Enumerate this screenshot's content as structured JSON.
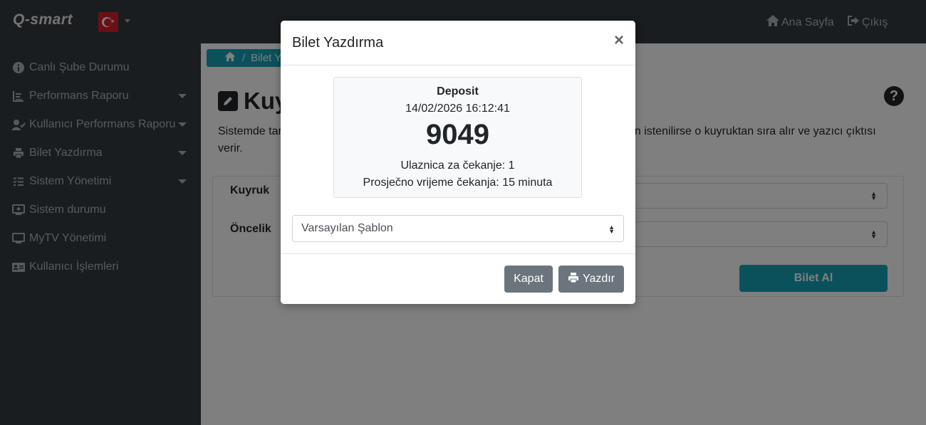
{
  "navbar": {
    "brand": "Q-smart",
    "flag_icon": "turkey-flag-icon",
    "home_label": "Ana Sayfa",
    "logout_label": "Çıkış"
  },
  "sidebar": {
    "items": [
      {
        "label": "Canlı Şube Durumu",
        "icon": "info-circle-icon",
        "has_caret": false
      },
      {
        "label": "Performans Raporu",
        "icon": "chart-icon",
        "has_caret": true
      },
      {
        "label": "Kullanıcı Performans Raporu",
        "icon": "user-check-icon",
        "has_caret": true
      },
      {
        "label": "Bilet Yazdırma",
        "icon": "printer-icon",
        "has_caret": true
      },
      {
        "label": "Sistem Yönetimi",
        "icon": "tasks-icon",
        "has_caret": true
      },
      {
        "label": "Sistem durumu",
        "icon": "monitor-icon",
        "has_caret": false
      },
      {
        "label": "MyTV Yönetimi",
        "icon": "tv-icon",
        "has_caret": false
      },
      {
        "label": "Kullanıcı İşlemleri",
        "icon": "id-card-icon",
        "has_caret": false
      }
    ]
  },
  "main": {
    "breadcrumb": "Bilet Y",
    "title": "Kuy",
    "desc_left": "Sistemde tar",
    "desc_left_line2": "verir.",
    "desc_right": "en istenilirse o kuyruktan sıra alır ve yazıcı çıktısı",
    "label_queue": "Kuyruk",
    "label_priority": "Öncelik",
    "bilet_button": "Bilet Al"
  },
  "modal": {
    "title": "Bilet Yazdırma",
    "close_symbol": "×",
    "ticket": {
      "service": "Deposit",
      "datetime": "14/02/2026 16:12:41",
      "number": "9049",
      "waiting": "Ulaznica za čekanje: 1",
      "avg_wait": "Prosječno vrijeme čekanja: 15 minuta"
    },
    "template_select": "Varsayılan Şablon",
    "close_button": "Kapat",
    "print_button": "Yazdır"
  },
  "colors": {
    "navbar_bg": "#343a40",
    "accent": "#17a2b8",
    "secondary_button": "#6c757d"
  }
}
